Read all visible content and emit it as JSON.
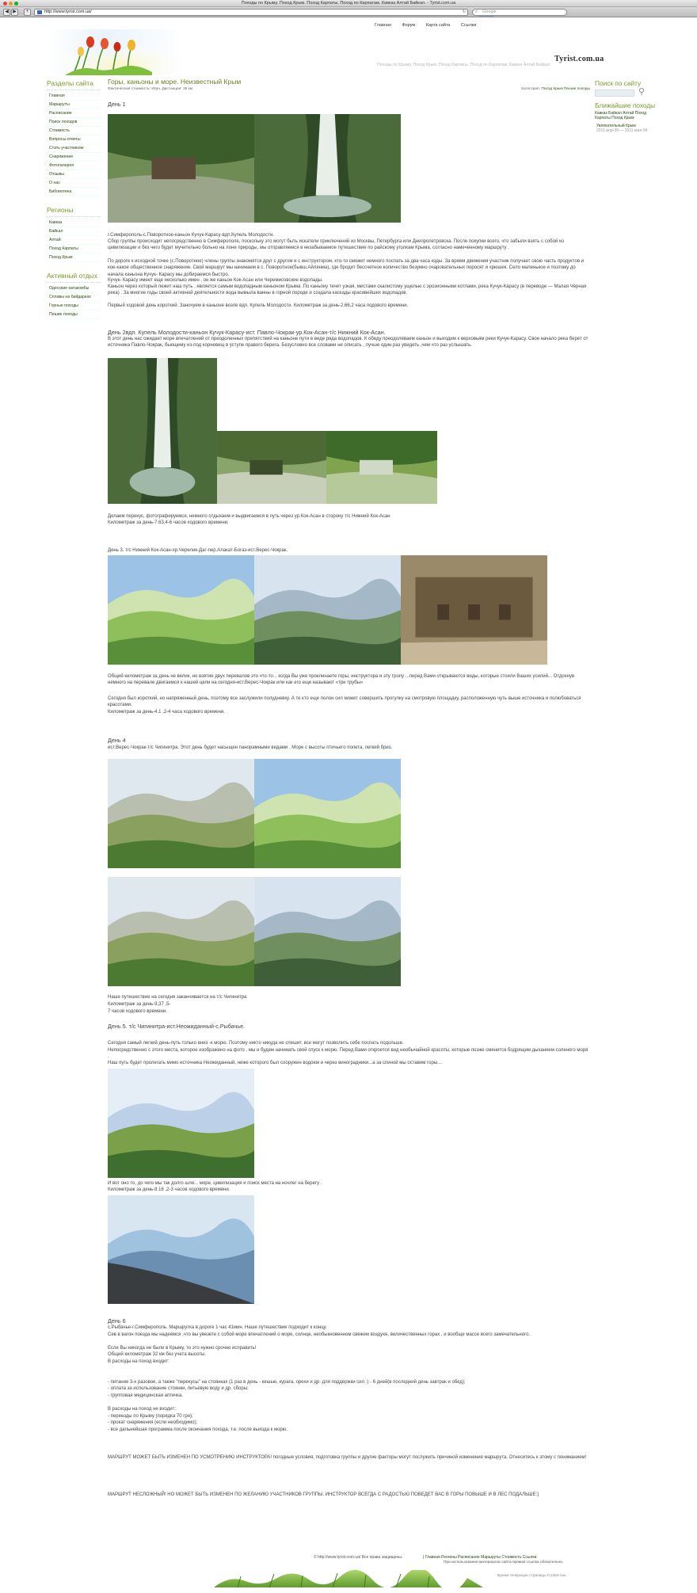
{
  "window": {
    "title": "Походы по Крыму. Поход Крым. Поход Карпаты. Поход по Карпатам. Кавказ Алтай Байкал. - Tyrist.com.ua",
    "url": "http://www.tyrist.com.ua/",
    "search_placeholder": "Google",
    "goto_label": "Google"
  },
  "topnav": [
    "Главная",
    "Форум",
    "Карта сайта",
    "Ссылки"
  ],
  "site_name": "Tyrist.com.ua",
  "tagline": "Походы по Крыму. Поход Крым. Поход Карпаты. Поход по Карпатам. Кавказ Алтай Байкал.",
  "sidebar": {
    "sections_title": "Разделы сайта",
    "sections": [
      "Главная",
      "Маршруты",
      "Расписание",
      "Поиск походов",
      "Стоимость",
      "Вопросы-ответы",
      "Стать участником",
      "Снаряжение",
      "Фотогалерея",
      "Отзывы",
      "О нас",
      "Библиотека"
    ],
    "regions_title": "Регионы",
    "regions": [
      "Кавказ",
      "Байкал",
      "Алтай",
      "Поход Карпаты",
      "Поход Крым"
    ],
    "active_title": "Активный отдых",
    "active": [
      "Одесские катакомбы",
      "Сплавы на байдарках",
      "Горные походы",
      "Пешие походы"
    ]
  },
  "page": {
    "title": "Горы, каньоны и море. Неизвестный Крым",
    "meta": "Фактическая стоимость: Игрн. Дистанция: 35 км",
    "category_label": "Категория:",
    "category_links": "Поход Крым Пешие походы",
    "day1_heading": "День 1",
    "route1": "г.Симферополь-с.Поворотное-каньон Кучук-Карасу-вдп.Купель Молодости.",
    "p1a": "Сбор группы происходит непосредственно в Симферополе, поскольку это могут быть искатели приключений из Москвы, Петербурга или Днепропетровска. После покупки всего, что забыли взять с собой из цивилизации и без чего будет мучительно больно на лоне природы, мы отправляемся в незабываемое путешествие по райскому уголкам Крыма, согласно намеченному маршруту .",
    "p1b": "По дороге к исходной точке (с.Поворотное) члены группы знакомятся друг с другом и с инструктором, кто-то сможет немного поспать за два часа езды. За время движения участник получает свою часть продуктов и кое-какое общественное снаряжение. Свой маршрут мы начинаем в с. Поворотное(бывш.Айлянма), где бродит бессчетное количество безумно очаровательных поросят и хрюшек. Село маленькое и поэтому до начала каньона Кучук- Карасу мы добираемся быстро.",
    "p1c": "Кучук- Карасу имеет еще несколько имен , он же каньон Кок-Асан или Черемисовские водопады.",
    "p1d": "Каньон через который лежит наш путь , является самым водопадным каньоном Крыма .По каньону течет узкая, местами скалистому ущелью с эрозионными котлами, река Кучук-Карасу (в переводе — Малая Чёрная река) . За многие годы своей активной деятельности вода вымыла ванны в горной породе и создала каскады красивейших водопадов.",
    "p1e": "Первый ходовой день короткий. Заночуем в каньоне возле вдп. Купель Молодости. Километраж за день-2.66,2 часа подового времени.",
    "day2": "День 2вдп. Купель Молодости-каньон Кучук-Карасу-ист. Павло-Чокрак-ур.Кок-Асан-т/с Нижний Кок-Асан.",
    "p2a": "В этот день нас ожидает море впечатлений от преодоленных препятствий на каньоне пути в виде ряда водопадов. К обеду преодолеваем каньон и выходим к верховьям реки Кучук-Карасу. Свое начало река берет от источника Павло-Чокрак, бьющему из-под корневищ в уступе правого берега. Безусловно все словами не описать , лучше один раз увидеть ,чем что раз услышать.",
    "p2b": "Делаем перекус, фотографируемся, немного отдыхаем и выдвигаемся в путь через ур.Кок-Асан в сторону т/с Нижний Кок-Асан",
    "p2c": "Километраж за день-7.63,4-6 часов ходового времени.",
    "day3": "День 3. т/с Нижний Кок-Асан-хр.Черелик-Даг-пер.Алакат-Богаз-ист.Верес-Чокрак.",
    "p3a": "Общий километраж за день не велик, но взятие двух перевалов это что-то... когда Вы уже проклинаете горы, инструктора и эту тропу ...перед Вами открываются виды, которые стоили Ваших усилий... Отдохнув немного на перевале двигаемся к нашей цели на сегодня-ист.Верес-Чокрак или как его еще называют «три трубы»",
    "p3b": "Сегодня был короткий, но напряженный день, поэтому все заслужили полудневку. А те кто еще полон сил может совершить прогулку на смотровую площадку, расположенную чуть выше источника и полюбоваться красотами.",
    "p3c": "Километраж за день-4.1 ,2-4 часа ходового времени.",
    "day4_heading": "День 4",
    "route4": "ист.Верес-Чокрак-т/с Чигинитра. Этот день будет насыщен панорамными видами . Море с высоты птичьего полета, легкий бриз.",
    "p4a": "Наше путешествие на сегодня заканчивается на т/с Чигинитра",
    "p4b": "Километраж за день-9,37 ,5-",
    "p4c": "7 часов ходового времени.",
    "day5": "День 5. т/с Чигинитра-ист.Неожиданный-с.Рыбачье.",
    "p5a": "Сегодня самый легкий день-путь только вниз -к морю. Поэтому никто никуда не спешит, все могут позволить себе поспать подольше.",
    "p5b": "Непосредственно с этого места, которое изображено на фото , мы и будем начинать свой спуск к морю. Перед Вами откроется вид необычайной красоты, которые позже сменится бодрящим дыханием соленого моря .",
    "p5c": "Наш путь будет пролегать мимо источника Неожиданный, ниже которого был сооружен водоем и через виноградники...а за спиной мы оставим горы...",
    "p5d": "И вот оно то, до чего мы так долго шли... море, цивилизация и поиск места на ночлег на берегу .",
    "p5e": "Километраж за день-8.16 ,2-3 часов ходового времени.",
    "day6_heading": "День 6",
    "p6a": "с.Рыбачье-г.Симферополь. Маршрутка в дороге 1 час 41мин. Наше путешествие подходит к концу.",
    "p6b": "Сев в вагон поезда мы надеемся ,что вы увезете с собой море впечатлений о море, солнце, необыкновенном свежем воздухе, величественных горах , и вообще массе всего замечательного.",
    "p6c": "Если Вы никогда не были в Крыму, то это нужно срочно исправить!",
    "p6d": "Общий километраж 32 км без учета высоты.",
    "p6e": "В расходы на поход входит:",
    "list1": [
      "- питание 3-х разовое, а также \"перекусы\" на стоянках (1 раз в день - кешью, курага, орехи и др. для поддержки сил :) - 6 дней(в последний день завтрак и обед);",
      "- оплата за использование стоянки, питьевую воду и др. сборы;",
      "- групповая медицинская аптечка."
    ],
    "p6f": "В расходы на поход не входит:",
    "list2": [
      "- переезды по Крыму (порядка 70 грн);",
      "- прокат снаряжения (если необходимо);",
      "- все дальнейшая программа после окончания похода, т.е. после выхода к морю."
    ],
    "warn1": "МАРШРУТ МОЖЕТ БЫТЬ ИЗМЕНЕН ПО УСМОТРЕНИЮ ИНСТРУКТОРА! погодные условия, подготовка группы и другие факторы могут послужить причиной изменения маршрута. Отнеситесь к этому с пониманием!",
    "warn2": "МАРШРУТ НЕСЛОЖНЫЙ! НО МОЖЕТ БЫТЬ ИЗМЕНЕН ПО ЖЕЛАНИЮ УЧАСТНИКОВ ГРУППЫ. ИНСТРУКТОР ВСЕГДА С РАДОСТЬЮ ПОВЕДЕТ ВАС В ГОРЫ ПОВЫШЕ И В ЛЕС ПОДАЛЬШЕ:)"
  },
  "right": {
    "search_title": "Поиск по сайту",
    "near_title": "Ближайшие походы",
    "near_links": "Кавказ Байкал Алтай Поход Карпаты Поход Крым",
    "event_name": "Увлекательный Крым",
    "event_dates": "2011-апр-29 — 2011-мая-04"
  },
  "footer": {
    "copyright": "© http://www.tyrist.com.ua/ Все права защищены.",
    "links": "| Главная Регионы Расписание Маршруты Стоимость Ссылки",
    "note": "При использовании материалов сайта прямая ссылка обязательна.",
    "gen_time": "Время генерации страницы 0.2459 сек."
  },
  "colors": {
    "accent": "#7a9a2e",
    "link": "#2a4a10"
  }
}
